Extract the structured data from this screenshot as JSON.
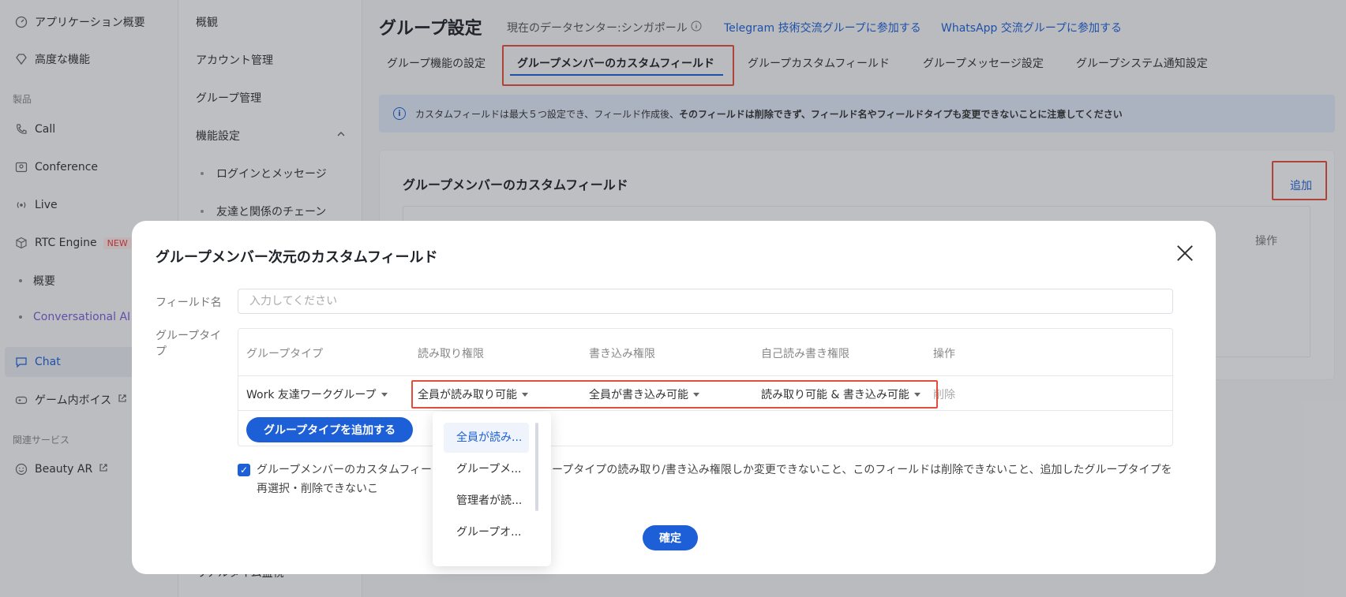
{
  "sidebar": {
    "items": [
      {
        "label": "アプリケーション概要",
        "icon": "dashboard-icon"
      },
      {
        "label": "高度な機能",
        "icon": "diamond-icon"
      }
    ],
    "section_products": "製品",
    "products": [
      {
        "label": "Call",
        "icon": "phone-icon"
      },
      {
        "label": "Conference",
        "icon": "conference-icon"
      },
      {
        "label": "Live",
        "icon": "live-icon"
      },
      {
        "label": "RTC Engine",
        "icon": "cube-icon",
        "badge": "NEW"
      }
    ],
    "subs": [
      "概要",
      "Conversational AI"
    ],
    "chat": {
      "label": "Chat",
      "icon": "chat-icon"
    },
    "voice": {
      "label": "ゲーム内ボイス",
      "icon": "gamepad-icon"
    },
    "section_related": "関連サービス",
    "beauty": {
      "label": "Beauty AR",
      "icon": "beauty-icon"
    }
  },
  "nav2": {
    "items": [
      "概観",
      "アカウント管理",
      "グループ管理",
      "機能設定"
    ],
    "subs": [
      "ログインとメッセージ",
      "友達と関係のチェーン"
    ],
    "bottom_partial": "リアルタイム監視"
  },
  "main": {
    "title": "グループ設定",
    "datacenter": "現在のデータセンター:シンガポール",
    "link_telegram": "Telegram 技術交流グループに参加する",
    "link_whatsapp": "WhatsApp 交流グループに参加する",
    "tabs": [
      "グループ機能の設定",
      "グループメンバーのカスタムフィールド",
      "グループカスタムフィールド",
      "グループメッセージ設定",
      "グループシステム通知設定"
    ],
    "info_text": "カスタムフィールドは最大５つ設定でき、フィールド作成後、",
    "info_bold": "そのフィールドは削除できず、フィールド名やフィールドタイプも変更できないことに注意してください",
    "card_title": "グループメンバーのカスタムフィールド",
    "card_add": "追加",
    "card_op": "操作"
  },
  "modal": {
    "title": "グループメンバー次元のカスタムフィールド",
    "field_name_label": "フィールド名",
    "field_name_placeholder": "入力してください",
    "group_type_label": "グループタイプ",
    "headers": [
      "グループタイプ",
      "読み取り権限",
      "書き込み権限",
      "自己読み書き権限",
      "操作"
    ],
    "row": {
      "group_type": "Work 友達ワークグループ",
      "read": "全員が読み取り可能",
      "write": "全員が書き込み可能",
      "self": "読み取り可能 & 書き込み可能",
      "action": "削除"
    },
    "add_group_type": "グループタイプを追加する",
    "agreement_part1": "グループメンバーのカスタムフィー",
    "agreement_part2": "加したグループタイプの読み取り/書き込み権限しか変更できないこと、このフィールドは削除できないこと、追加したグループタイプを再選択・削除できないこ",
    "confirm": "確定"
  },
  "dropdown": {
    "options": [
      "全員が読み...",
      "グループメ...",
      "管理者が読...",
      "グループオ..."
    ]
  },
  "colors": {
    "accent": "#1d5fd6",
    "highlight": "#e34d3b"
  }
}
